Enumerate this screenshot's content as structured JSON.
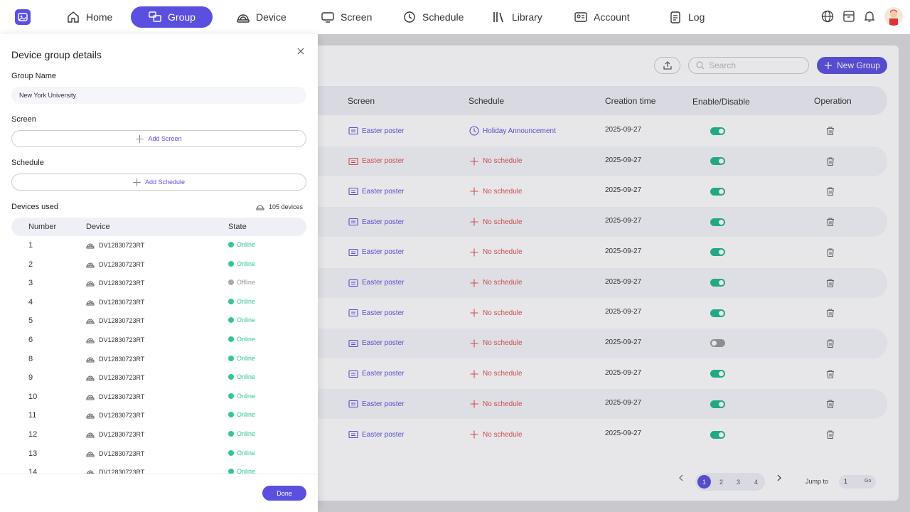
{
  "nav": {
    "home": "Home",
    "group": "Group",
    "device": "Device",
    "screen": "Screen",
    "schedule": "Schedule",
    "library": "Library",
    "account": "Account",
    "log": "Log"
  },
  "toolbar": {
    "search_placeholder": "Search",
    "new_group": "New Group"
  },
  "table": {
    "headers": {
      "screen": "Screen",
      "schedule": "Schedule",
      "creation": "Creation time",
      "enable": "Enable/Disable",
      "operation": "Operation"
    },
    "rows": [
      {
        "screen": "Easter poster",
        "screen_status": "ok",
        "schedule": "Holiday Announcement",
        "has_schedule": true,
        "date": "2025-09-27",
        "enabled": true
      },
      {
        "screen": "Easter poster",
        "screen_status": "error",
        "schedule": "No schedule",
        "has_schedule": false,
        "date": "2025-09-27",
        "enabled": true
      },
      {
        "screen": "Easter poster",
        "screen_status": "ok",
        "schedule": "No schedule",
        "has_schedule": false,
        "date": "2025-09-27",
        "enabled": true
      },
      {
        "screen": "Easter poster",
        "screen_status": "ok",
        "schedule": "No schedule",
        "has_schedule": false,
        "date": "2025-09-27",
        "enabled": true
      },
      {
        "screen": "Easter poster",
        "screen_status": "ok",
        "schedule": "No schedule",
        "has_schedule": false,
        "date": "2025-09-27",
        "enabled": true
      },
      {
        "screen": "Easter poster",
        "screen_status": "ok",
        "schedule": "No schedule",
        "has_schedule": false,
        "date": "2025-09-27",
        "enabled": true
      },
      {
        "screen": "Easter poster",
        "screen_status": "ok",
        "schedule": "No schedule",
        "has_schedule": false,
        "date": "2025-09-27",
        "enabled": true
      },
      {
        "screen": "Easter poster",
        "screen_status": "ok",
        "schedule": "No schedule",
        "has_schedule": false,
        "date": "2025-09-27",
        "enabled": false
      },
      {
        "screen": "Easter poster",
        "screen_status": "ok",
        "schedule": "No schedule",
        "has_schedule": false,
        "date": "2025-09-27",
        "enabled": true
      },
      {
        "screen": "Easter poster",
        "screen_status": "ok",
        "schedule": "No schedule",
        "has_schedule": false,
        "date": "2025-09-27",
        "enabled": true
      },
      {
        "screen": "Easter poster",
        "screen_status": "ok",
        "schedule": "No schedule",
        "has_schedule": false,
        "date": "2025-09-27",
        "enabled": true
      }
    ]
  },
  "pagination": {
    "pages": [
      "1",
      "2",
      "3",
      "4"
    ],
    "current": "1",
    "jump_label": "Jump to",
    "jump_value": "1",
    "go": "Go"
  },
  "drawer": {
    "title": "Device group details",
    "group_name_label": "Group Name",
    "group_name_value": "New York University",
    "screen_label": "Screen",
    "add_screen": "Add Screen",
    "schedule_label": "Schedule",
    "add_schedule": "Add Schedule",
    "devices_used_label": "Devices used",
    "devices_count": "105 devices",
    "headers": {
      "number": "Number",
      "device": "Device",
      "state": "State"
    },
    "devices": [
      {
        "number": "1",
        "device": "DV12830723RT",
        "state": "Online"
      },
      {
        "number": "2",
        "device": "DV12830723RT",
        "state": "Online"
      },
      {
        "number": "3",
        "device": "DV12830723RT",
        "state": "Offline"
      },
      {
        "number": "4",
        "device": "DV12830723RT",
        "state": "Online"
      },
      {
        "number": "5",
        "device": "DV12830723RT",
        "state": "Online"
      },
      {
        "number": "6",
        "device": "DV12830723RT",
        "state": "Online"
      },
      {
        "number": "8",
        "device": "DV12830723RT",
        "state": "Online"
      },
      {
        "number": "9",
        "device": "DV12830723RT",
        "state": "Online"
      },
      {
        "number": "10",
        "device": "DV12830723RT",
        "state": "Online"
      },
      {
        "number": "11",
        "device": "DV12830723RT",
        "state": "Online"
      },
      {
        "number": "12",
        "device": "DV12830723RT",
        "state": "Online"
      },
      {
        "number": "13",
        "device": "DV12830723RT",
        "state": "Online"
      },
      {
        "number": "14",
        "device": "DV12830723RT",
        "state": "Online"
      }
    ],
    "done": "Done"
  },
  "colors": {
    "accent": "#5b4fe0",
    "online": "#2fc98f",
    "toggle_on": "#1fb88e",
    "error": "#e05050"
  }
}
